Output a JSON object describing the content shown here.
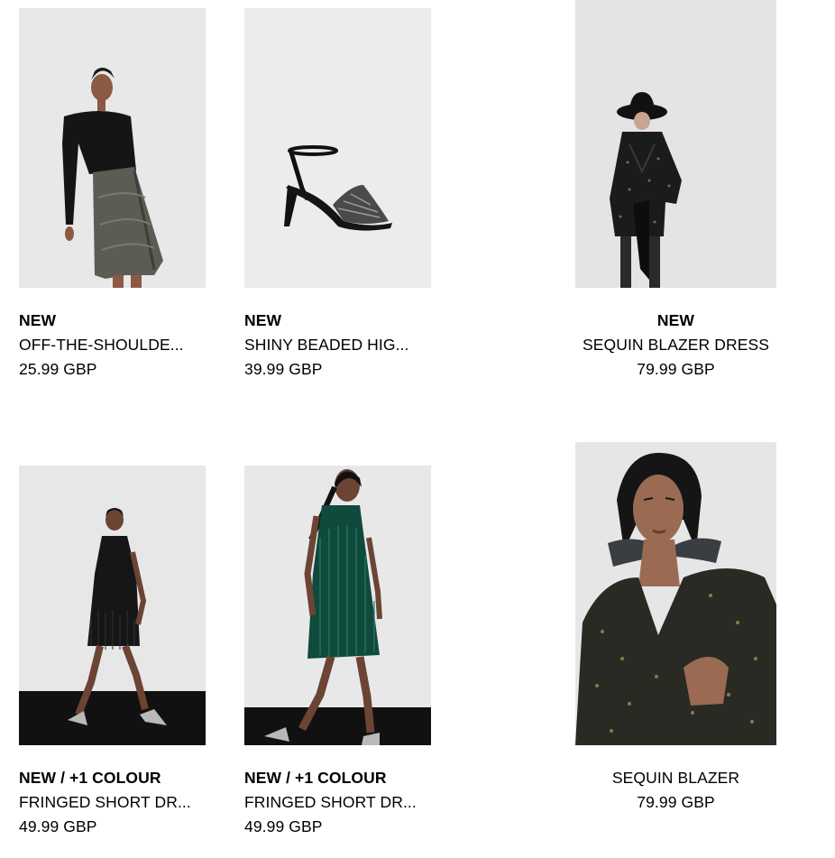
{
  "products": [
    {
      "tag": "NEW",
      "name": "OFF-THE-SHOULDE...",
      "price": "25.99 GBP",
      "image_icon": "product-photo-icon"
    },
    {
      "tag": "NEW",
      "name": "SHINY BEADED HIG...",
      "price": "39.99 GBP",
      "image_icon": "product-photo-icon"
    },
    {
      "tag": "NEW",
      "name": "SEQUIN BLAZER DRESS",
      "price": "79.99 GBP",
      "image_icon": "product-photo-icon"
    },
    {
      "tag": "NEW / +1 COLOUR",
      "name": "FRINGED SHORT DR...",
      "price": "49.99 GBP",
      "image_icon": "product-photo-icon"
    },
    {
      "tag": "NEW / +1 COLOUR",
      "name": "FRINGED SHORT DR...",
      "price": "49.99 GBP",
      "image_icon": "product-photo-icon"
    },
    {
      "tag": "",
      "name": "SEQUIN BLAZER",
      "price": "79.99 GBP",
      "image_icon": "product-photo-icon"
    }
  ],
  "colors": {
    "backdrop": "#e6e6e6",
    "floor": "#111111",
    "green_dress": "#0f4a3c",
    "black": "#111111"
  }
}
